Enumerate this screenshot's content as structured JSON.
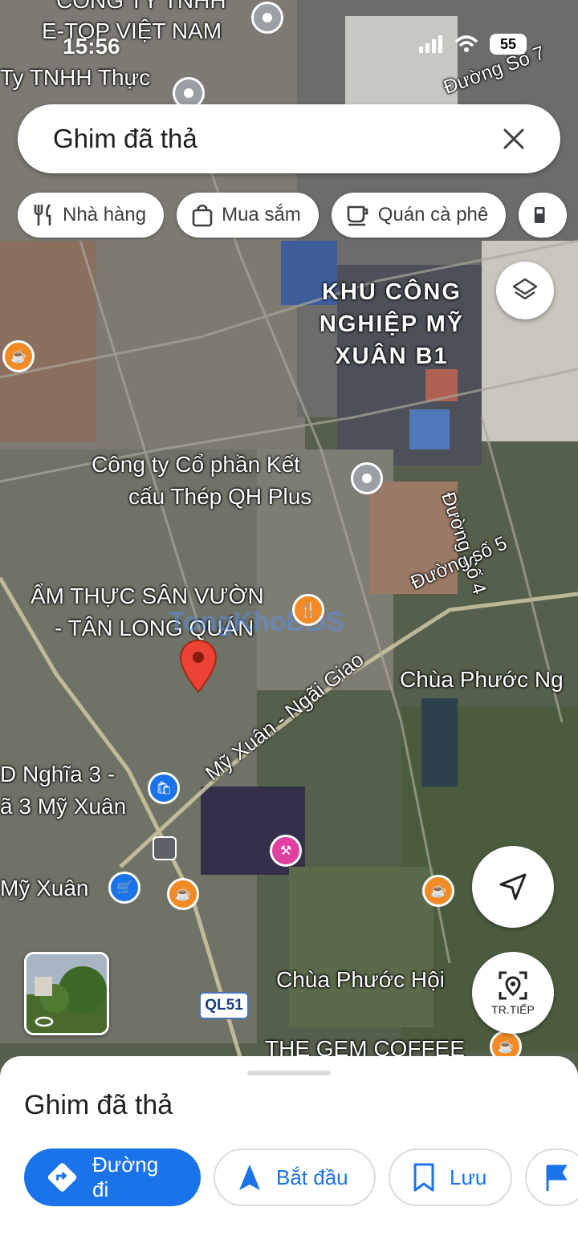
{
  "status_bar": {
    "time": "15:56",
    "battery": "55"
  },
  "search": {
    "title": "Ghim đã thả"
  },
  "chips": [
    {
      "label": "Nhà hàng",
      "icon": "fork-knife-icon"
    },
    {
      "label": "Mua sắm",
      "icon": "shopping-bag-icon"
    },
    {
      "label": "Quán cà phê",
      "icon": "coffee-cup-icon"
    }
  ],
  "map_labels": {
    "e_top": "E-TOP VIỆT NAM",
    "cong_ty_top": "CÔNG TY TNHH",
    "ty_tnhh_thuc": "Ty TNHH Thực",
    "duong_so_7": "Đường Số 7",
    "khu_cong_nghiep": "KHU CÔNG NGHIỆP MỸ XUÂN B1",
    "qh_plus_line1": "Công ty Cổ phần Kết",
    "qh_plus_line2": "cấu Thép QH Plus",
    "duong_so_4": "Đường Số 4",
    "duong_so_5": "Đường số 5",
    "am_thuc_line1": "ẨM THỰC SÂN VƯỜN",
    "am_thuc_line2": "- TÂN LONG QUÁN",
    "my_xuan_ngai_giao": "Mỹ Xuân - Ngãi Giao",
    "chua_phuoc_ng": "Chùa Phước Ng",
    "nghia_3": "D Nghĩa 3 -",
    "a3_my_xuan": "ã 3 Mỹ Xuân",
    "my_xuan": "Mỹ Xuân",
    "chua_phuoc_hoi": "Chùa Phước Hội",
    "the_gem_coffee": "THE GEM COFFEE",
    "road_shield": "QL51",
    "watermark": "TongKhoBDS"
  },
  "fabs": {
    "track_label": "TR.TIẾP"
  },
  "sheet": {
    "title": "Ghim đã thả",
    "actions": [
      {
        "label": "Đường đi",
        "icon": "directions-icon"
      },
      {
        "label": "Bắt đầu",
        "icon": "navigation-arrow-icon"
      },
      {
        "label": "Lưu",
        "icon": "bookmark-icon"
      }
    ]
  },
  "colors": {
    "accent": "#1a73e8",
    "pin_red": "#ea4335",
    "poi_orange": "#f28b26",
    "poi_blue": "#1a73e8",
    "poi_pink": "#e040a0"
  }
}
